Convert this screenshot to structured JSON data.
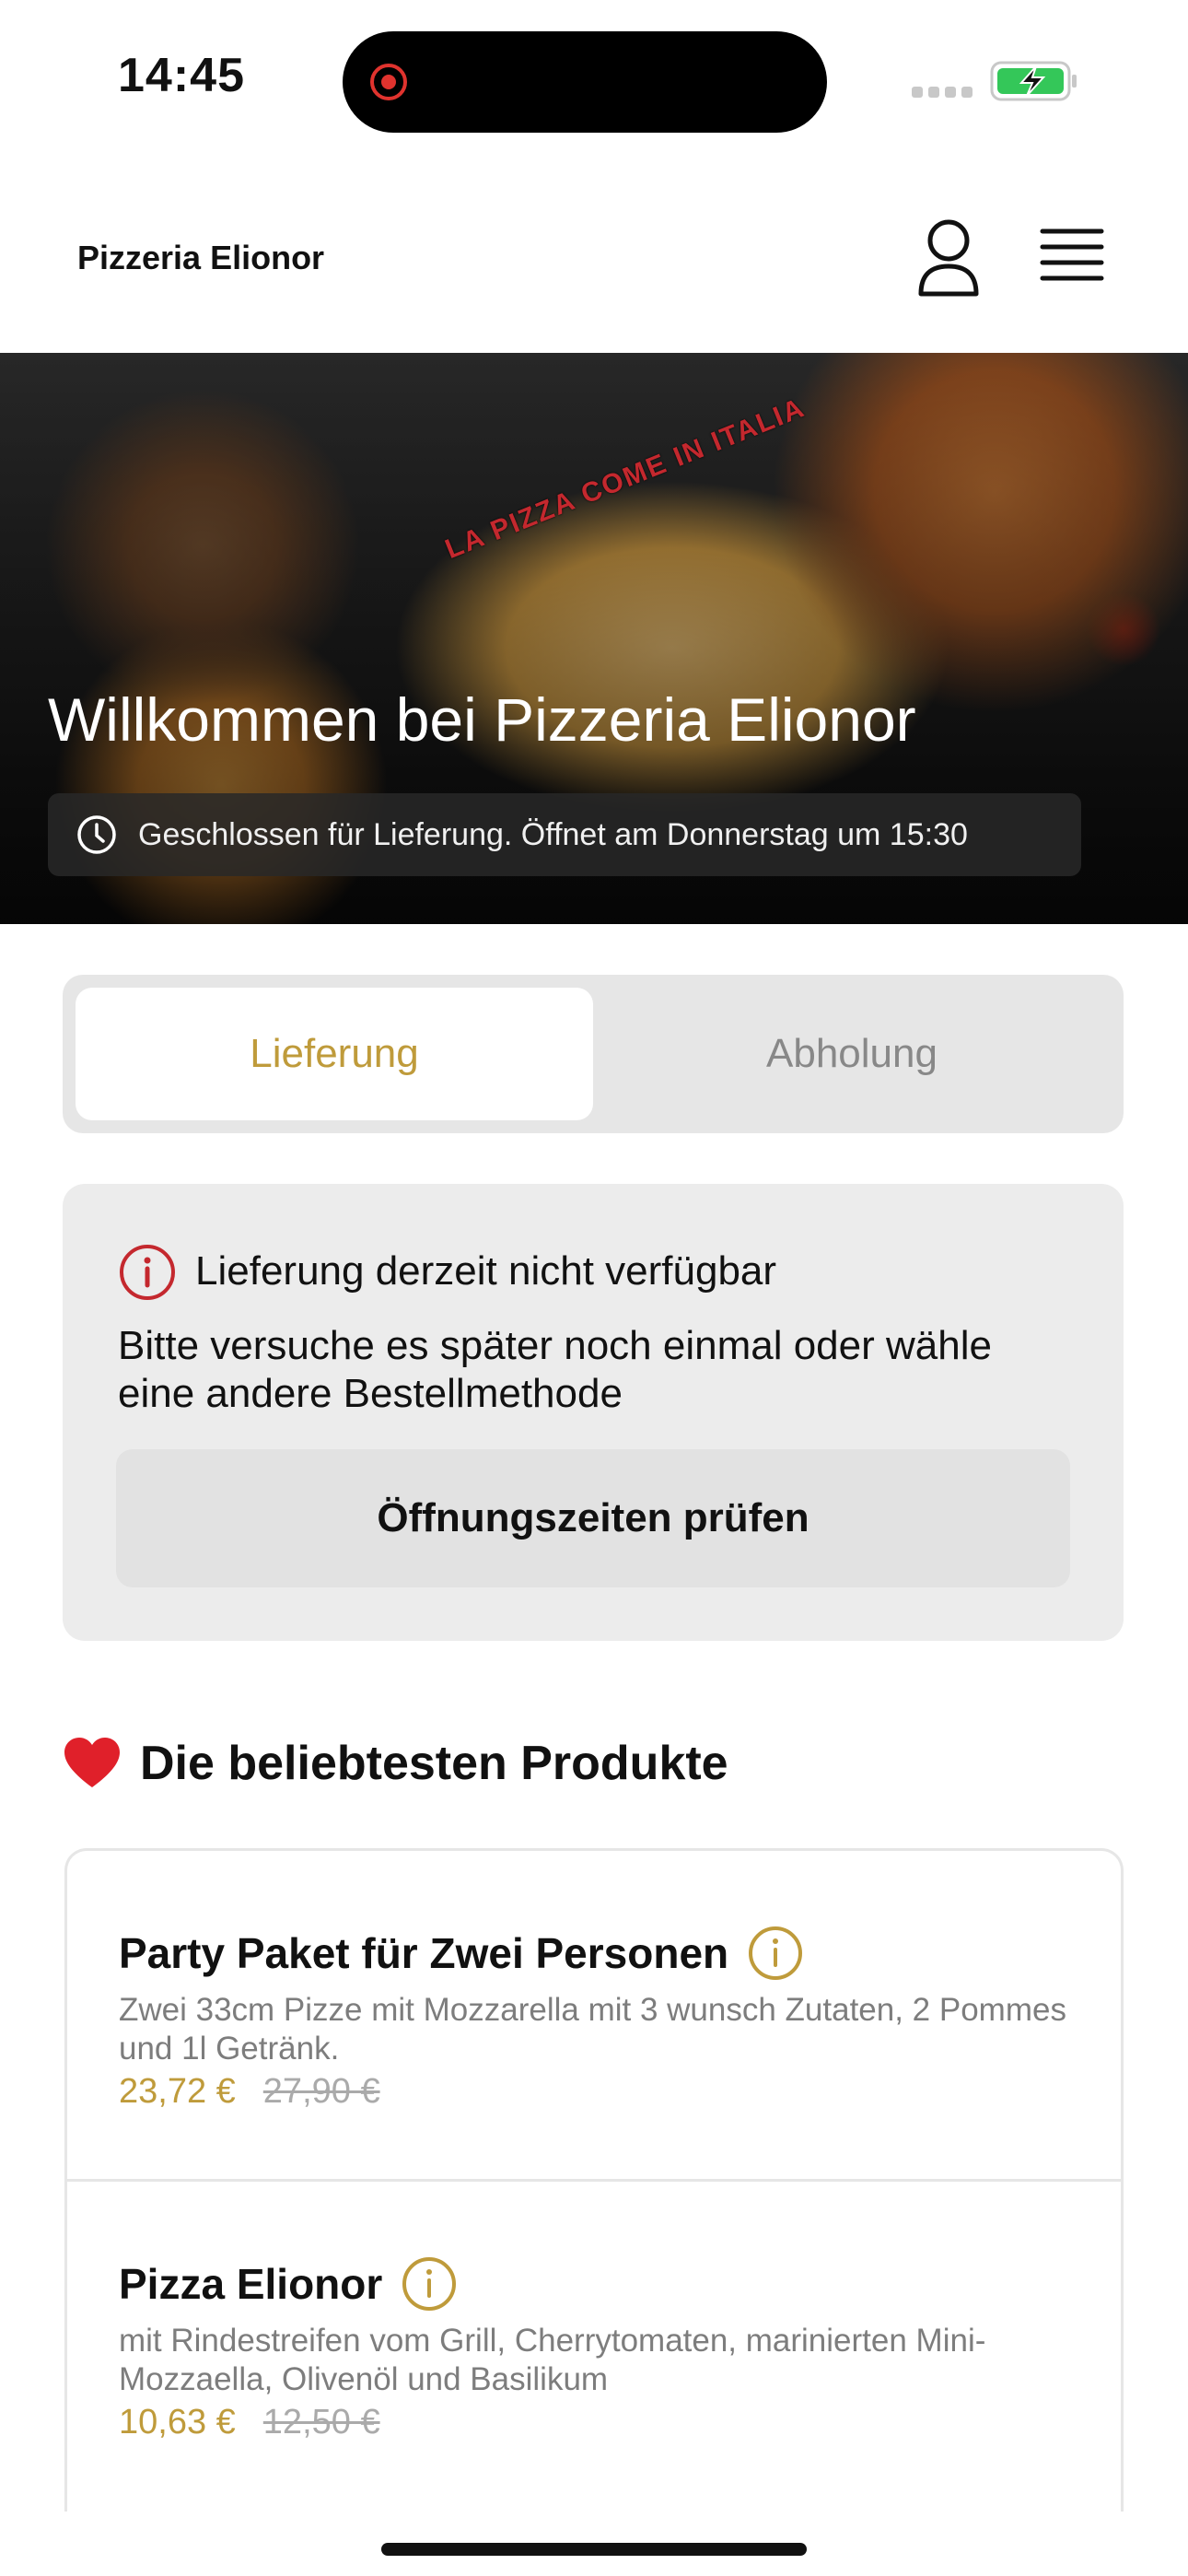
{
  "status_bar": {
    "time": "14:45"
  },
  "header": {
    "brand": "Pizzeria Elionor"
  },
  "hero": {
    "stamp": "LA PIZZA COME IN ITALIA",
    "title": "Willkommen bei Pizzeria Elionor",
    "status": "Geschlossen für Lieferung. Öffnet am Donnerstag um 15:30"
  },
  "segment": {
    "delivery": "Lieferung",
    "pickup": "Abholung",
    "active": "delivery"
  },
  "notice": {
    "title": "Lieferung derzeit nicht verfügbar",
    "text": "Bitte versuche es später noch einmal oder wähle eine andere Bestellmethode",
    "button": "Öffnungszeiten prüfen"
  },
  "popular": {
    "title": "Die beliebtesten Produkte",
    "products": [
      {
        "name": "Party Paket für Zwei Personen",
        "description": "Zwei 33cm Pizze mit Mozzarella mit 3 wunsch Zutaten, 2 Pommes und 1l Getränk.",
        "price": "23,72 €",
        "old_price": "27,90 €"
      },
      {
        "name": "Pizza Elionor",
        "description": "mit Rindestreifen vom Grill, Cherrytomaten, marinierten Mini-Mozzaella, Olivenöl und Basilikum",
        "price": "10,63 €",
        "old_price": "12,50 €"
      }
    ]
  },
  "colors": {
    "accent": "#bf9b3b",
    "alert": "#c4282e",
    "battery": "#34c759"
  },
  "icons": [
    "recording-icon",
    "signal-icon",
    "battery-charging-icon",
    "user-icon",
    "menu-icon",
    "clock-icon",
    "alert-icon",
    "heart-icon",
    "info-icon"
  ]
}
